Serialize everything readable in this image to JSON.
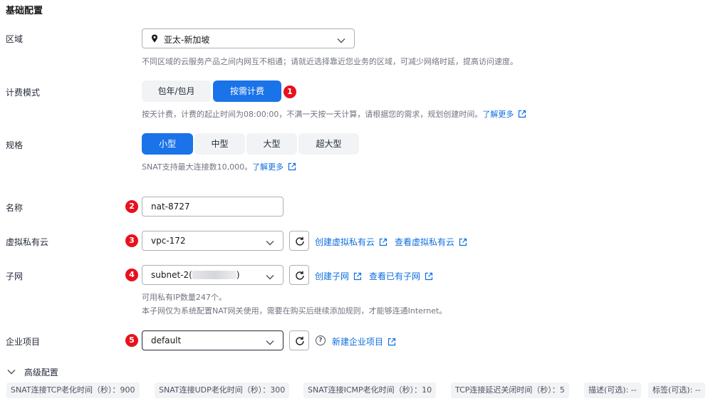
{
  "section_title": "基础配置",
  "region": {
    "label": "区域",
    "value": "亚太-新加坡",
    "hint": "不同区域的云服务产品之间内网互不相通；请就近选择靠近您业务的区域，可减少网络时延，提高访问速度。"
  },
  "billing": {
    "label": "计费模式",
    "options": [
      "包年/包月",
      "按需计费"
    ],
    "selected": "按需计费",
    "badge": "1",
    "hint": "按天计费，计费的起止时间为08:00:00，不满一天按一天计算，请根据您的需求，规划创建时间。",
    "learn_more": "了解更多"
  },
  "spec": {
    "label": "规格",
    "options": [
      "小型",
      "中型",
      "大型",
      "超大型"
    ],
    "selected": "小型",
    "hint": "SNAT支持最大连接数10,000。",
    "learn_more": "了解更多"
  },
  "name": {
    "label": "名称",
    "badge": "2",
    "value": "nat-8727"
  },
  "vpc": {
    "label": "虚拟私有云",
    "badge": "3",
    "value": "vpc-172",
    "create_link": "创建虚拟私有云",
    "view_link": "查看虚拟私有云"
  },
  "subnet": {
    "label": "子网",
    "badge": "4",
    "value_prefix": "subnet-2(",
    "value_suffix": ")",
    "create_link": "创建子网",
    "view_link": "查看已有子网",
    "hint_line1": "可用私有IP数量247个。",
    "hint_line2": "本子网仅为系统配置NAT网关使用，需要在购买后继续添加规则，才能够连通Internet。"
  },
  "enterprise": {
    "label": "企业项目",
    "badge": "5",
    "value": "default",
    "help_icon": "?",
    "create_link": "新建企业项目"
  },
  "advanced": {
    "title": "高级配置",
    "chips": [
      "SNAT连接TCP老化时间（秒）：900",
      "SNAT连接UDP老化时间（秒）：300",
      "SNAT连接ICMP老化时间（秒）：10",
      "TCP连接延迟关闭时间（秒）：5",
      "描述(可选): --",
      "标签(可选): --"
    ]
  },
  "colors": {
    "primary": "#1a73e8",
    "link": "#0d6ee0",
    "badge": "#e8111c",
    "hint": "#71757f"
  }
}
